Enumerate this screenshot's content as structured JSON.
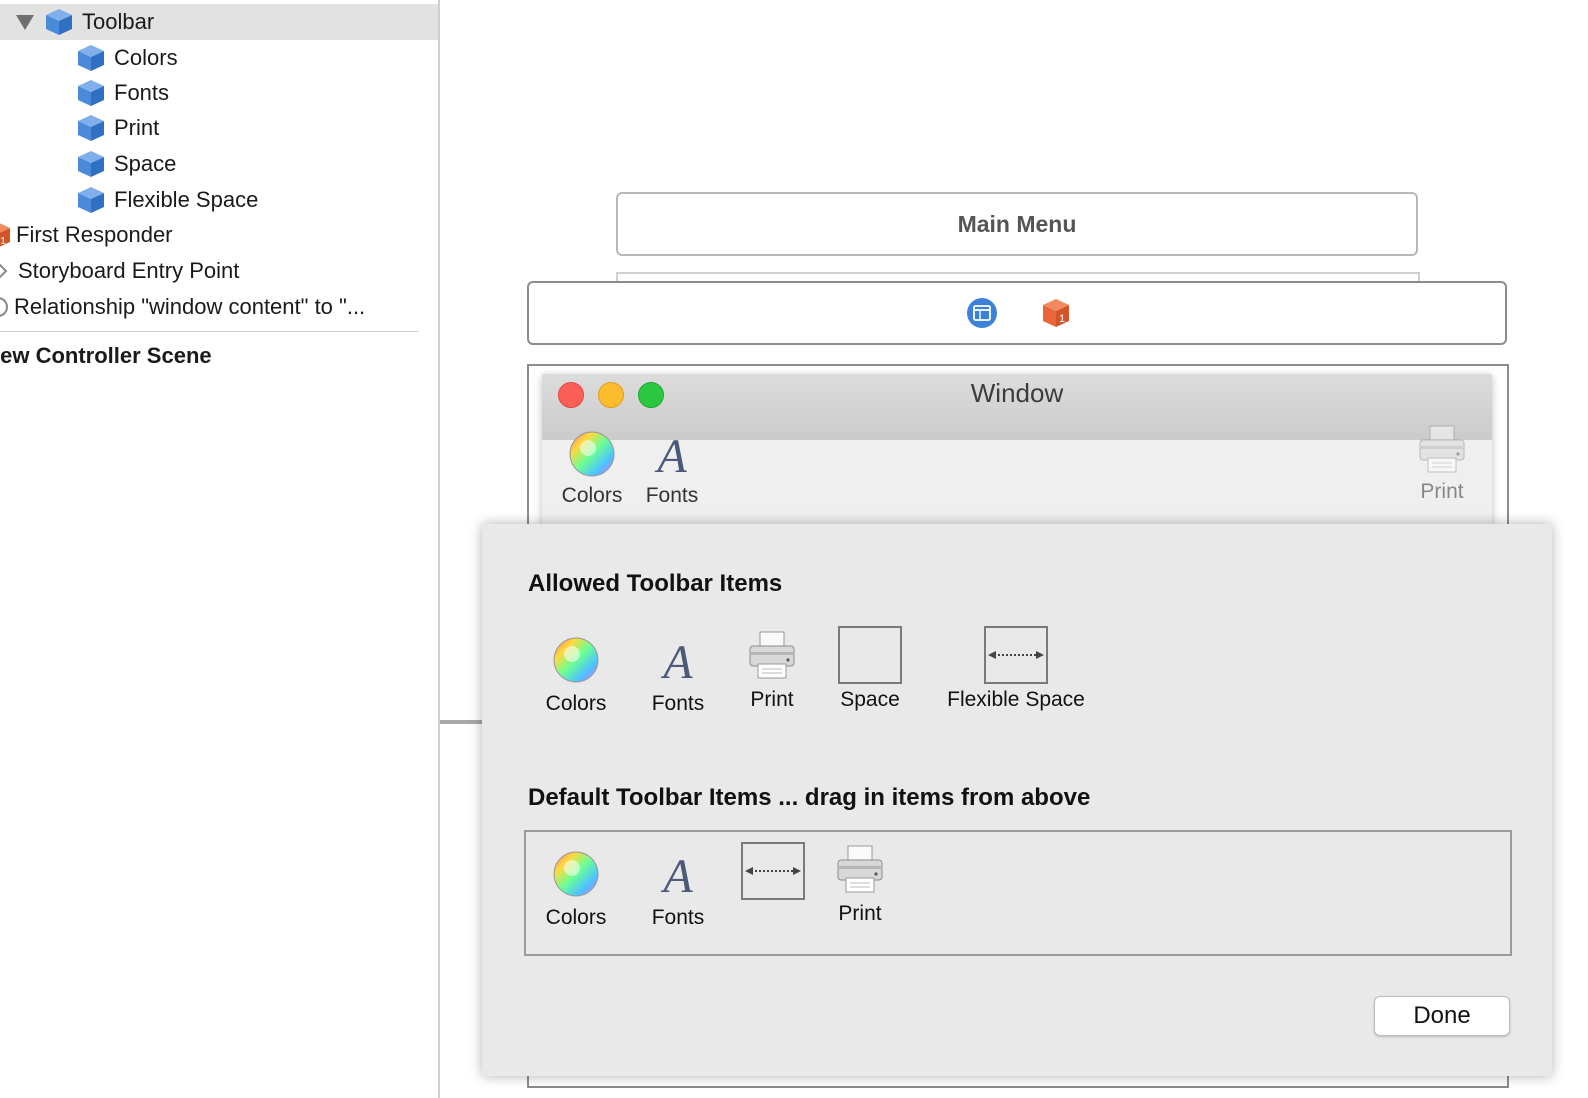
{
  "outline": {
    "items": [
      {
        "label": "Toolbar",
        "icon": "cube-icon",
        "expanded": true,
        "selected": true
      },
      {
        "label": "Colors",
        "icon": "cube-icon"
      },
      {
        "label": "Fonts",
        "icon": "cube-icon"
      },
      {
        "label": "Print",
        "icon": "cube-icon"
      },
      {
        "label": "Space",
        "icon": "cube-icon"
      },
      {
        "label": "Flexible Space",
        "icon": "cube-icon"
      },
      {
        "label": "First Responder",
        "icon": "first-responder-icon"
      },
      {
        "label": "Storyboard Entry Point",
        "icon": "entry-arrow-icon"
      },
      {
        "label": "Relationship \"window content\" to \"...",
        "icon": "relationship-icon"
      }
    ],
    "scene_title": "iew Controller Scene"
  },
  "canvas": {
    "main_menu_label": "Main Menu",
    "window": {
      "title": "Window",
      "toolbar_items": [
        {
          "label": "Colors",
          "icon": "color-wheel-icon"
        },
        {
          "label": "Fonts",
          "icon": "fonts-icon"
        },
        {
          "label": "Print",
          "icon": "printer-icon"
        }
      ]
    }
  },
  "customize_sheet": {
    "allowed_heading": "Allowed Toolbar Items",
    "allowed_items": [
      {
        "label": "Colors",
        "icon": "color-wheel-icon"
      },
      {
        "label": "Fonts",
        "icon": "fonts-icon"
      },
      {
        "label": "Print",
        "icon": "printer-icon"
      },
      {
        "label": "Space",
        "icon": "space-icon"
      },
      {
        "label": "Flexible Space",
        "icon": "flexible-space-icon"
      }
    ],
    "default_heading": "Default Toolbar Items ... drag in items from above",
    "default_items": [
      {
        "label": "Colors",
        "icon": "color-wheel-icon"
      },
      {
        "label": "Fonts",
        "icon": "fonts-icon"
      },
      {
        "label": "",
        "icon": "flexible-space-icon"
      },
      {
        "label": "Print",
        "icon": "printer-icon"
      }
    ],
    "done_label": "Done"
  },
  "colors": {
    "cube_blue": "#4a8ad8",
    "responder_orange": "#e8663a",
    "close_red": "#fc5f57",
    "minimize_yellow": "#fdbb2e",
    "zoom_green": "#2ac840"
  }
}
